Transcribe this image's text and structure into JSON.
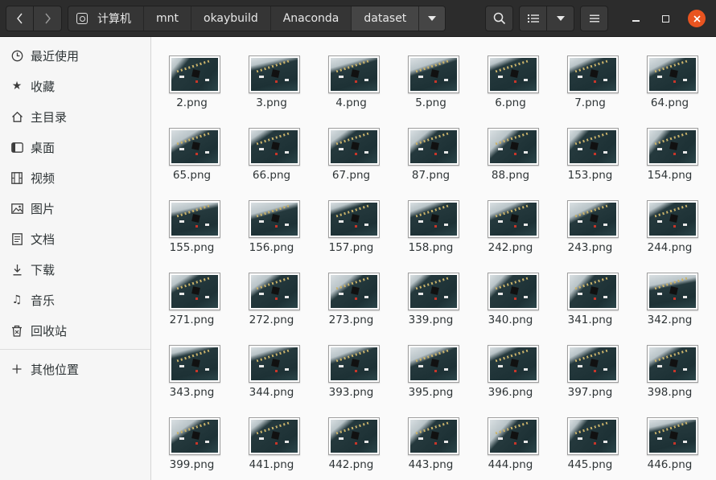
{
  "window": {
    "breadcrumb": [
      "计算机",
      "mnt",
      "okaybuild",
      "Anaconda",
      "dataset"
    ],
    "buttons": {
      "back_icon": "chevron-left-icon",
      "forward_icon": "chevron-right-icon",
      "search_icon": "search-icon",
      "view_icon": "list-view-icon",
      "view_options_icon": "chevron-down-icon",
      "menu_icon": "hamburger-menu-icon",
      "minimize_icon": "minimize-icon",
      "maximize_icon": "maximize-icon",
      "close_icon": "close-icon"
    },
    "accent_close": "#e95420"
  },
  "sidebar": {
    "items": [
      {
        "label": "最近使用",
        "icon": "clock-icon"
      },
      {
        "label": "收藏",
        "icon": "star-icon"
      },
      {
        "label": "主目录",
        "icon": "home-icon"
      },
      {
        "label": "桌面",
        "icon": "desktop-icon"
      },
      {
        "label": "视频",
        "icon": "film-icon"
      },
      {
        "label": "图片",
        "icon": "image-icon"
      },
      {
        "label": "文档",
        "icon": "document-icon"
      },
      {
        "label": "下载",
        "icon": "download-icon"
      },
      {
        "label": "音乐",
        "icon": "music-icon"
      },
      {
        "label": "回收站",
        "icon": "trash-icon"
      },
      {
        "label": "其他位置",
        "icon": "plus-icon"
      }
    ]
  },
  "files": [
    "2.png",
    "3.png",
    "4.png",
    "5.png",
    "6.png",
    "7.png",
    "64.png",
    "65.png",
    "66.png",
    "67.png",
    "87.png",
    "88.png",
    "153.png",
    "154.png",
    "155.png",
    "156.png",
    "157.png",
    "158.png",
    "242.png",
    "243.png",
    "244.png",
    "271.png",
    "272.png",
    "273.png",
    "339.png",
    "340.png",
    "341.png",
    "342.png",
    "343.png",
    "344.png",
    "393.png",
    "395.png",
    "396.png",
    "397.png",
    "398.png",
    "399.png",
    "441.png",
    "442.png",
    "443.png",
    "444.png",
    "445.png",
    "446.png"
  ]
}
